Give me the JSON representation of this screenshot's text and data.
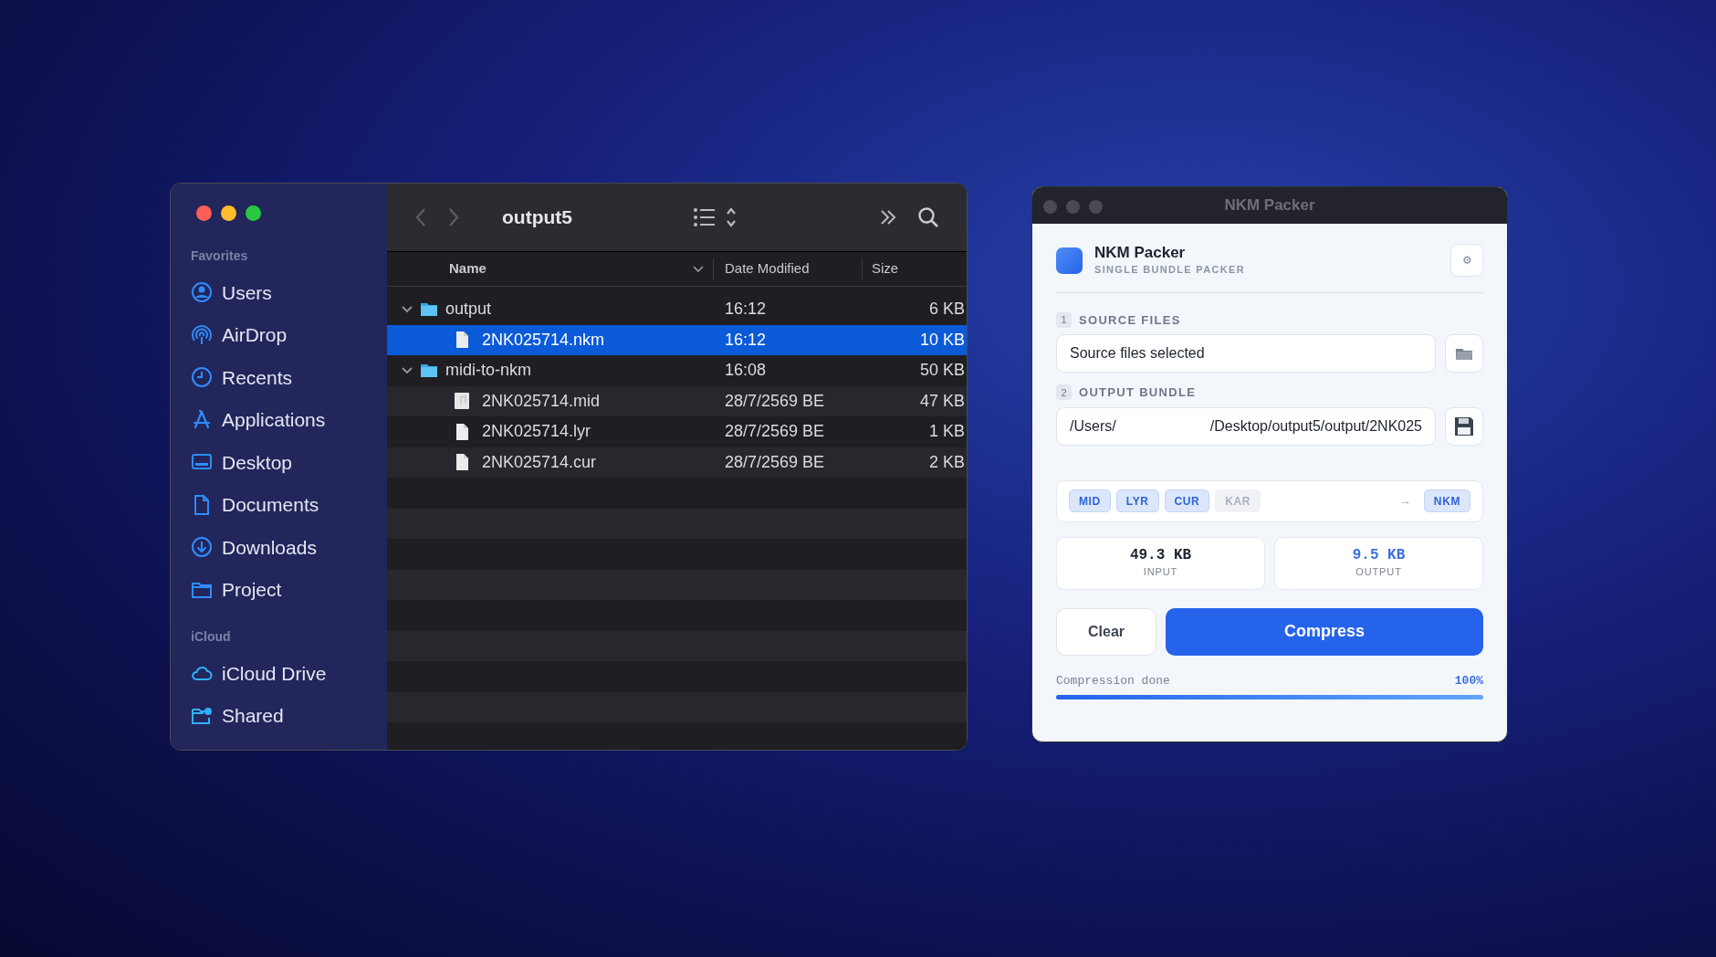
{
  "finder": {
    "title": "output5",
    "sidebar": [
      {
        "heading": "Favorites",
        "items": [
          {
            "label": "Users"
          },
          {
            "label": "AirDrop"
          },
          {
            "label": "Recents"
          },
          {
            "label": "Applications"
          },
          {
            "label": "Desktop"
          },
          {
            "label": "Documents"
          },
          {
            "label": "Downloads"
          },
          {
            "label": "Project"
          }
        ]
      },
      {
        "heading": "iCloud",
        "items": [
          {
            "label": "iCloud Drive"
          },
          {
            "label": "Shared"
          }
        ]
      }
    ],
    "columns": [
      "Name",
      "Date Modified",
      "Size"
    ],
    "rows": [
      {
        "name": "output",
        "kind": "folder",
        "expanded": true,
        "selected": false,
        "date": "16:12",
        "size": "6 KB",
        "children": [
          {
            "name": "2NK025714.nkm",
            "kind": "file",
            "selected": true,
            "date": "16:12",
            "size": "10 KB"
          }
        ]
      },
      {
        "name": "midi-to-nkm",
        "kind": "folder",
        "expanded": true,
        "selected": false,
        "date": "16:08",
        "size": "50 KB",
        "children": [
          {
            "name": "2NK025714.mid",
            "kind": "audio",
            "selected": false,
            "date": "28/7/2569 BE",
            "size": "47 KB"
          },
          {
            "name": "2NK025714.lyr",
            "kind": "file",
            "selected": false,
            "date": "28/7/2569 BE",
            "size": "1 KB"
          },
          {
            "name": "2NK025714.cur",
            "kind": "file",
            "selected": false,
            "date": "28/7/2569 BE",
            "size": "2 KB"
          }
        ]
      }
    ]
  },
  "packer": {
    "window_title": "NKM Packer",
    "app_name": "NKM Packer",
    "subtitle": "SINGLE BUNDLE PACKER",
    "settings_icon": "⚙",
    "source": {
      "step": "1",
      "label": "SOURCE FILES",
      "value": "Source files selected"
    },
    "output": {
      "step": "2",
      "label": "OUTPUT BUNDLE",
      "value_start": "/Users/",
      "value_end": "/Desktop/output5/output/2NK025"
    },
    "formats": [
      {
        "label": "MID",
        "active": true
      },
      {
        "label": "LYR",
        "active": true
      },
      {
        "label": "CUR",
        "active": true
      },
      {
        "label": "KAR",
        "active": false
      }
    ],
    "arrow": "→",
    "target": "NKM",
    "stats": [
      {
        "value": "49.3 KB",
        "label": "INPUT",
        "kind": "input"
      },
      {
        "value": "9.5 KB",
        "label": "OUTPUT",
        "kind": "output"
      }
    ],
    "buttons": {
      "clear": "Clear",
      "compress": "Compress"
    },
    "progress": {
      "label": "Compression done",
      "reading": "100%",
      "level": 1
    }
  }
}
